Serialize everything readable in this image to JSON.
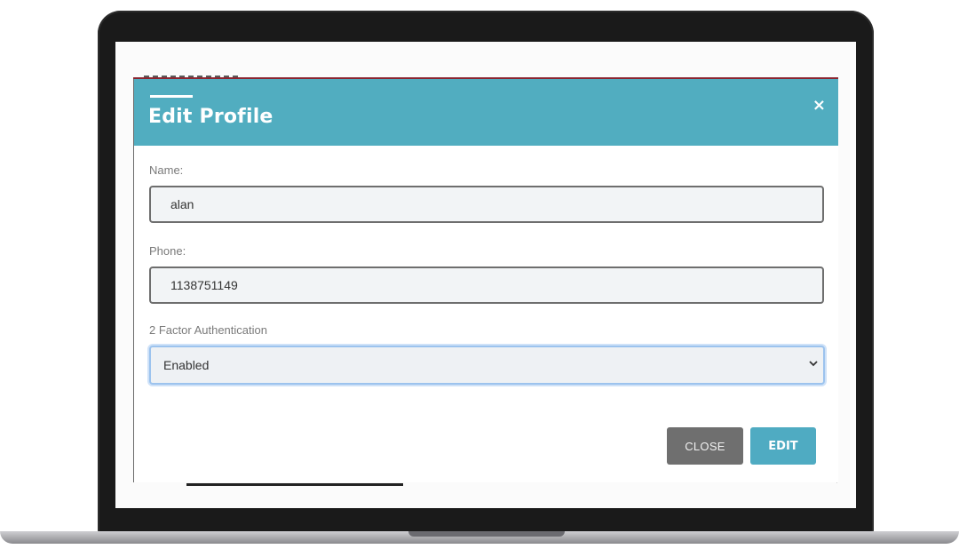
{
  "modal": {
    "title": "Edit Profile",
    "close_icon": "×"
  },
  "form": {
    "name_label": "Name:",
    "name_value": "alan",
    "phone_label": "Phone:",
    "phone_value": "1138751149",
    "twofa_label": "2 Factor Authentication",
    "twofa_selected": "Enabled"
  },
  "footer": {
    "close_label": "CLOSE",
    "edit_label": "EDIT"
  },
  "colors": {
    "header": "#51adc0",
    "close_button": "#6f6f6f",
    "edit_button": "#4fabc2"
  },
  "icons": {
    "close": "close-icon",
    "select": "chevron-down-icon"
  }
}
